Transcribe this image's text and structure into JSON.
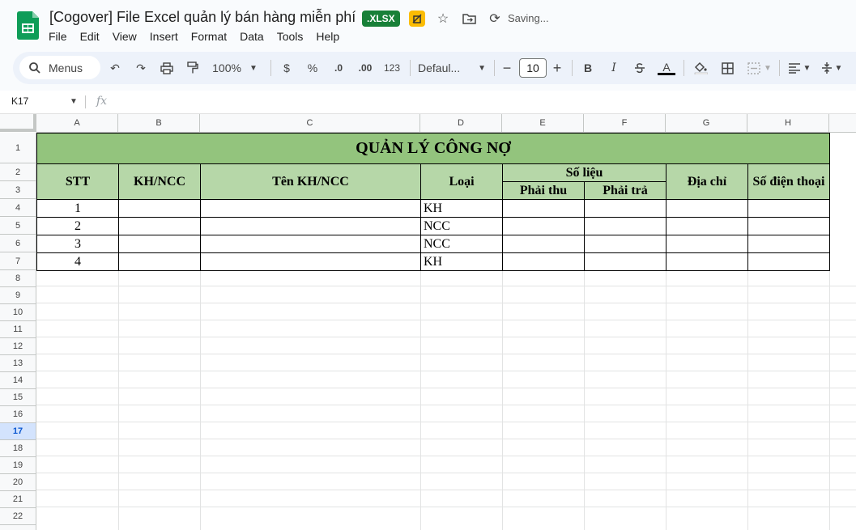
{
  "window": {
    "title": "[Cogover] File Excel quản lý bán hàng miễn phí",
    "badge": ".XLSX",
    "save_status": "Saving..."
  },
  "menu": [
    "File",
    "Edit",
    "View",
    "Insert",
    "Format",
    "Data",
    "Tools",
    "Help"
  ],
  "toolbar": {
    "search_label": "Menus",
    "zoom": "100%",
    "currency": "$",
    "percent": "%",
    "decrease_decimal": ".0",
    "increase_decimal": ".00",
    "number_format": "123",
    "font": "Defaul...",
    "font_size": "10",
    "bold": "B",
    "italic": "I",
    "text_color": "A"
  },
  "formula_bar": {
    "name_box": "K17",
    "fx_label": "fx",
    "formula": ""
  },
  "columns": [
    "A",
    "B",
    "C",
    "D",
    "E",
    "F",
    "G",
    "H"
  ],
  "rows": [
    "1",
    "2",
    "3",
    "4",
    "5",
    "6",
    "7",
    "8",
    "9",
    "10",
    "11",
    "12",
    "13",
    "14",
    "15",
    "16",
    "17",
    "18",
    "19",
    "20",
    "21",
    "22"
  ],
  "active_row": "17",
  "sheet": {
    "title": "QUẢN LÝ CÔNG NỢ",
    "headers": {
      "stt": "STT",
      "kh_ncc": "KH/NCC",
      "ten": "Tên KH/NCC",
      "loai": "Loại",
      "so_lieu": "Số liệu",
      "phai_thu": "Phải thu",
      "phai_tra": "Phải trả",
      "dia_chi": "Địa chỉ",
      "sdt": "Số điện thoại"
    },
    "rows": [
      {
        "stt": "1",
        "loai": "KH"
      },
      {
        "stt": "2",
        "loai": "NCC"
      },
      {
        "stt": "3",
        "loai": "NCC"
      },
      {
        "stt": "4",
        "loai": "KH"
      }
    ]
  },
  "colors": {
    "title_green": "#93c47d",
    "header_green": "#b6d7a8",
    "badge_green": "#188038"
  }
}
